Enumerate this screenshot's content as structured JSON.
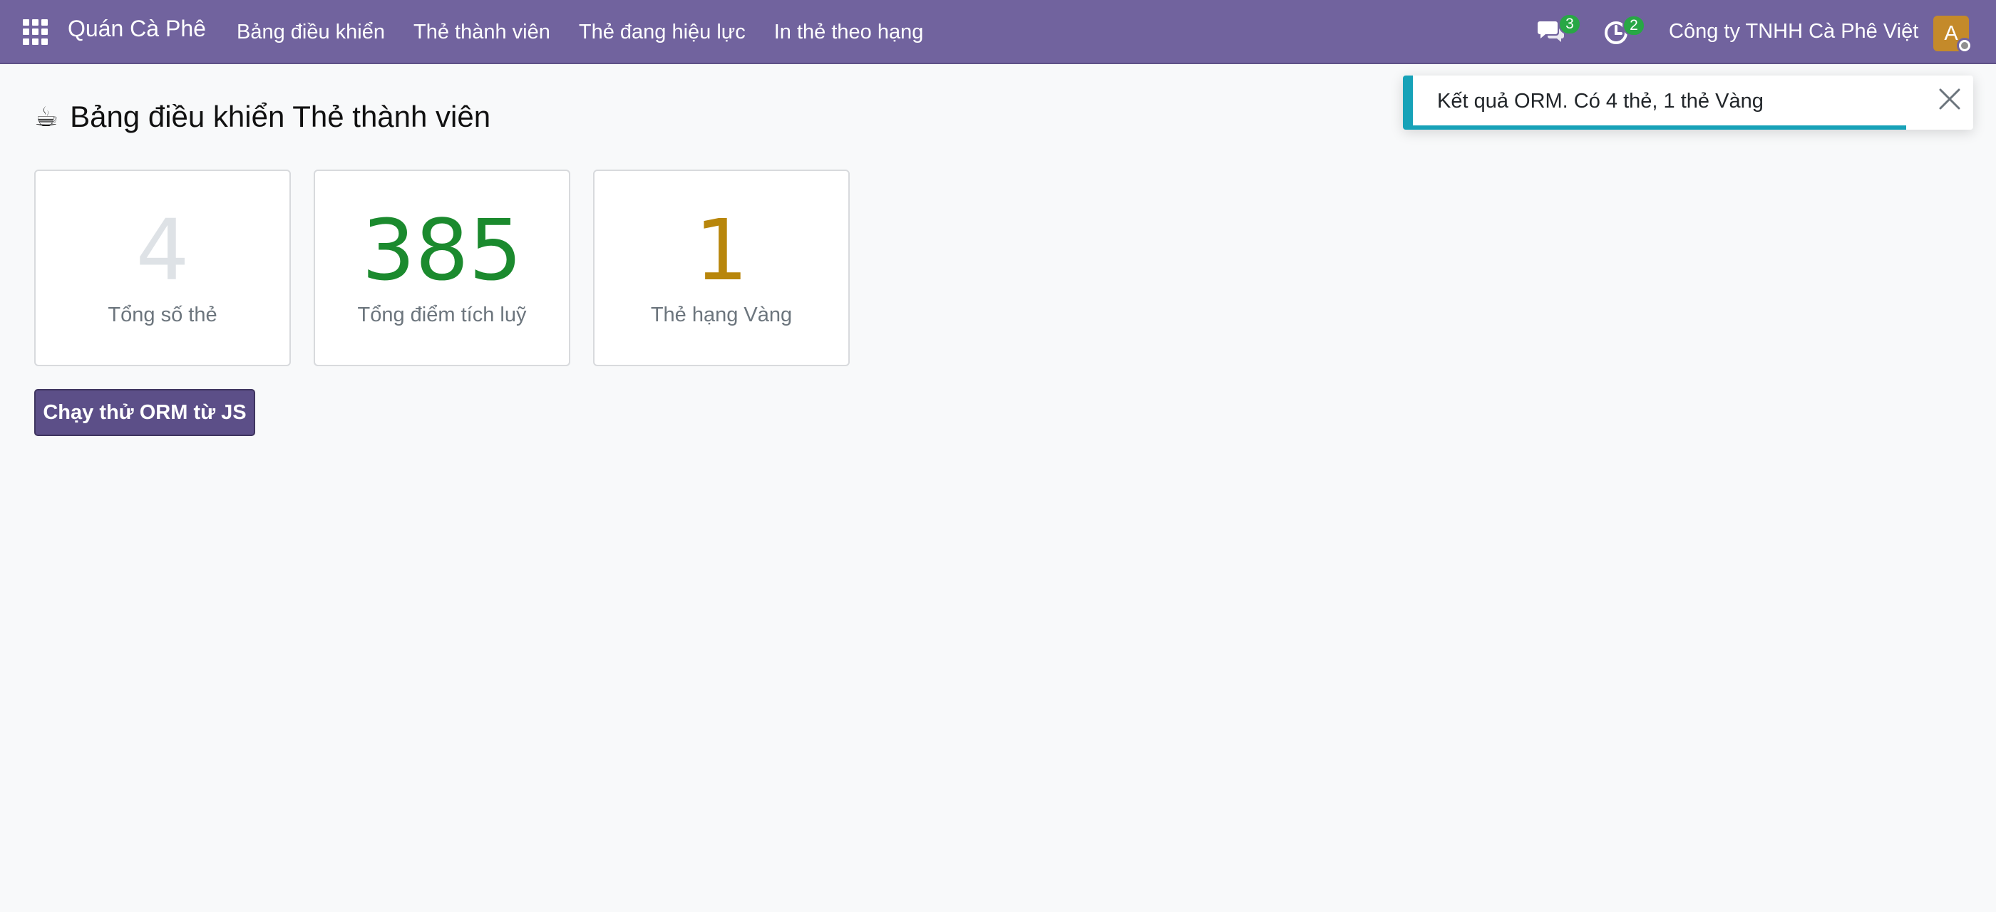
{
  "navbar": {
    "brand": "Quán Cà Phê",
    "menu": [
      {
        "label": "Bảng điều khiển"
      },
      {
        "label": "Thẻ thành viên"
      },
      {
        "label": "Thẻ đang hiệu lực"
      },
      {
        "label": "In thẻ theo hạng"
      }
    ],
    "chat_badge": "3",
    "activity_badge": "2",
    "company": "Công ty TNHH Cà Phê Việt",
    "avatar_initial": "A",
    "icons": [
      "apps-grid-icon",
      "chat-icon",
      "activity-clock-icon",
      "presence-status-icon"
    ],
    "color": "#71639e"
  },
  "page": {
    "title_icon": "☕",
    "title": "Bảng điều khiển Thẻ thành viên"
  },
  "stats": [
    {
      "value": "4",
      "label": "Tổng số thẻ",
      "color": "#dee2e6"
    },
    {
      "value": "385",
      "label": "Tổng điểm tích luỹ",
      "color": "#1b8a2e"
    },
    {
      "value": "1",
      "label": "Thẻ hạng Vàng",
      "color": "#b8860b"
    }
  ],
  "actions": {
    "run_orm_label": "Chạy thử ORM từ JS"
  },
  "toast": {
    "message": "Kết quả ORM. Có 4 thẻ, 1 thẻ Vàng",
    "type": "info",
    "accent": "#17a2b8",
    "progress": 0.88
  }
}
